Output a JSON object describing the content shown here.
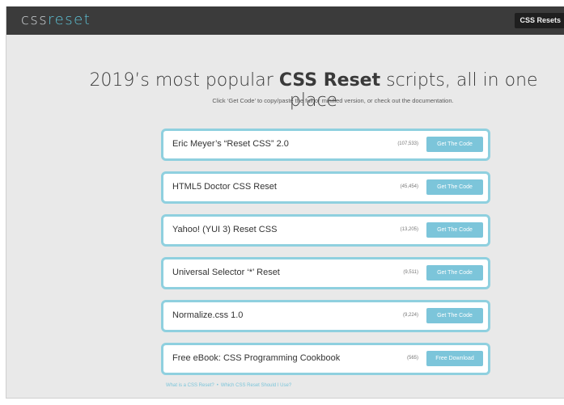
{
  "header": {
    "logo_main": "css",
    "logo_accent": "reset",
    "nav_button": "CSS Resets"
  },
  "hero": {
    "headline_pre": "2019’s most popular ",
    "headline_bold": "CSS Reset",
    "headline_post": " scripts, all in one place",
    "subline": "Click ‘Get Code’ to copy/paste the full or minified version, or check out the documentation."
  },
  "resets": [
    {
      "name": "Eric Meyer’s “Reset CSS” 2.0",
      "count": "(107,533)",
      "button": "Get The Code"
    },
    {
      "name": "HTML5 Doctor CSS Reset",
      "count": "(45,454)",
      "button": "Get The Code"
    },
    {
      "name": "Yahoo! (YUI 3) Reset CSS",
      "count": "(13,205)",
      "button": "Get The Code"
    },
    {
      "name": "Universal Selector ‘*’ Reset",
      "count": "(9,511)",
      "button": "Get The Code"
    },
    {
      "name": "Normalize.css 1.0",
      "count": "(9,224)",
      "button": "Get The Code"
    },
    {
      "name": "Free eBook: CSS Programming Cookbook",
      "count": "(565)",
      "button": "Free Download"
    }
  ],
  "footer": {
    "link1": "What is a CSS Reset?",
    "separator": "•",
    "link2": "Which CSS Reset Should I Use?"
  },
  "colors": {
    "topbar": "#3b3b3b",
    "accent": "#5ec4d8",
    "button": "#7cc5da",
    "card_border": "#8fd0df",
    "page_bg": "#e9e9e9"
  }
}
